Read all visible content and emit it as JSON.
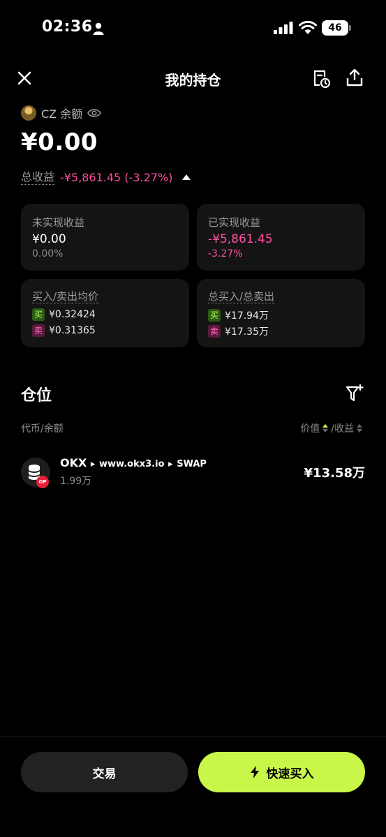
{
  "status_bar": {
    "time": "02:36",
    "battery": "46"
  },
  "header": {
    "title": "我的持仓"
  },
  "account": {
    "label": "CZ 余额",
    "balance": "¥0.00"
  },
  "pnl": {
    "label": "总收益",
    "value": "-¥5,861.45 (-3.27%)"
  },
  "cards": {
    "unrealized": {
      "label": "未实现收益",
      "value": "¥0.00",
      "sub": "0.00%"
    },
    "realized": {
      "label": "已实现收益",
      "value": "-¥5,861.45",
      "sub": "-3.27%"
    },
    "avg_price": {
      "label": "买入/卖出均价",
      "buy_tag": "买",
      "buy": "¥0.32424",
      "sell_tag": "卖",
      "sell": "¥0.31365"
    },
    "totals": {
      "label": "总买入/总卖出",
      "buy_tag": "买",
      "buy": "¥17.94万",
      "sell_tag": "卖",
      "sell": "¥17.35万"
    }
  },
  "positions": {
    "title": "仓位",
    "col_left": "代币/余额",
    "col_value": "价值",
    "col_pnl": "/收益",
    "items": [
      {
        "name": "OKX",
        "arrow": "▸",
        "site": "www.okx3.io",
        "type": "SWAP",
        "badge": "OP",
        "amount": "1.99万",
        "value": "¥13.58万"
      }
    ]
  },
  "actions": {
    "trade": "交易",
    "quick_buy": "快速买入"
  },
  "colors": {
    "accent": "#c8f74a",
    "negative": "#ff4fa0",
    "background": "#000000",
    "card": "#141414"
  }
}
